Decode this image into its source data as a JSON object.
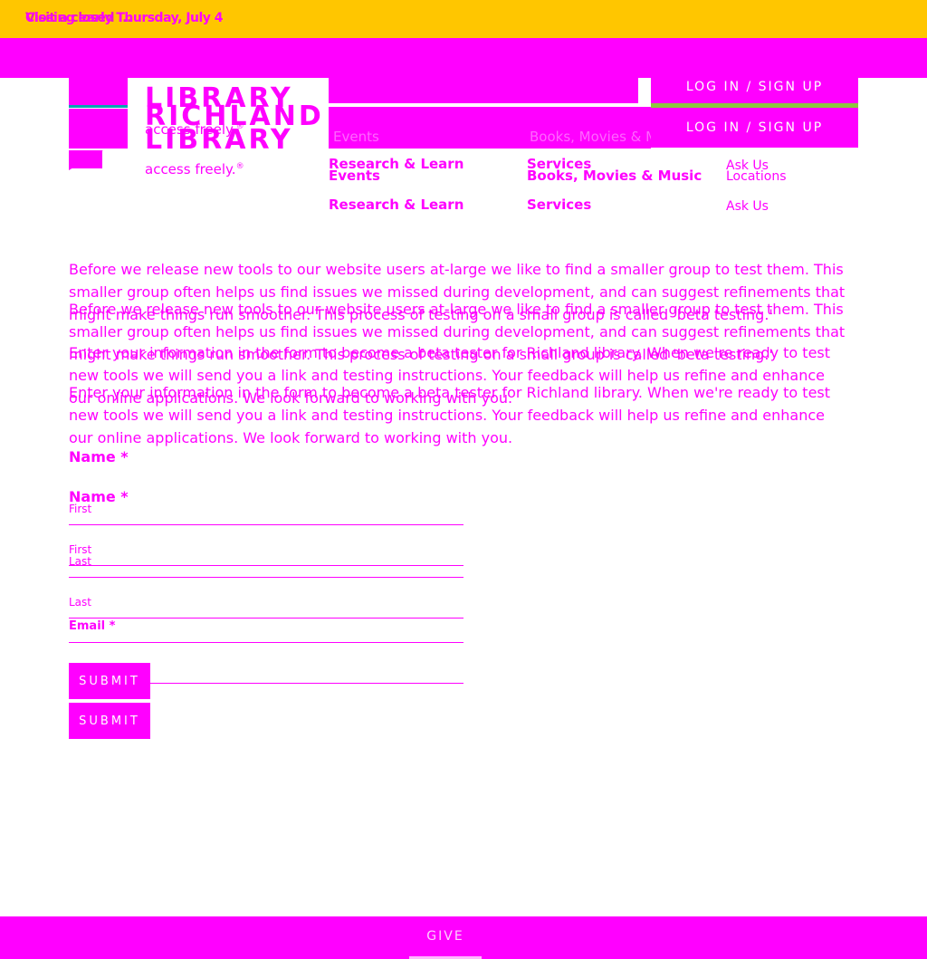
{
  "alert": {
    "closing_text": "Closing early Thursday, July 4",
    "visit_text": "Visit a closed ..."
  },
  "logo": {
    "word1": "RICHLAND",
    "word2": "LIBRARY",
    "tagline": "access freely.",
    "registered": "®"
  },
  "header": {
    "login_label": "LOG IN / SIGN UP"
  },
  "nav_bar": {
    "item1": "Events",
    "item2": "Books, Movies & Music"
  },
  "nav": {
    "events": "Events",
    "books": "Books, Movies & Music",
    "locations": "Locations",
    "research": "Research & Learn",
    "services": "Services",
    "ask_us": "Ask Us"
  },
  "content": {
    "intro": "Before we release new tools to our website users at-large we like to find a smaller group to test them. This smaller group often helps us find issues we missed during development, and can suggest refinements that might make things run smoother. This process of testing on a small group is called 'beta testing.'",
    "signup": "Enter your information in the form to become a beta tester for Richland library. When we're ready to test new tools we will send you a link and testing instructions. Your feedback will help us refine and enhance our online applications. We look forward to working with you."
  },
  "form": {
    "name_label": "Name *",
    "first_label": "First",
    "last_label": "Last",
    "email_label": "Email *",
    "submit_label": "SUBMIT"
  },
  "footer": {
    "give_label": "GIVE"
  },
  "colors": {
    "accent": "#ff00ff",
    "alert": "#ffc600",
    "teal": "#00a6b4",
    "green": "#8dc63f"
  }
}
